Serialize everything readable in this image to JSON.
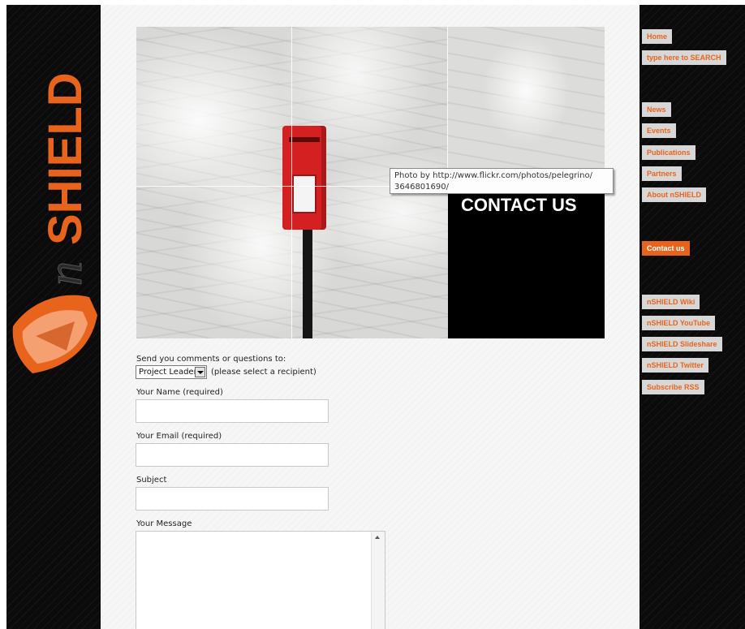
{
  "logo": {
    "text_n": "n",
    "text_shield": "SHIELD",
    "shield_color": "#e8641c"
  },
  "hero": {
    "title": "CONTACT US",
    "tooltip": "Photo by http://www.flickr.com/photos/pelegrino/ 3646801690/"
  },
  "form": {
    "recipient_intro": "Send you comments or questions to:",
    "recipient_selected": "Project Leader",
    "recipient_hint": "(please select a recipient)",
    "name_label": "Your Name (required)",
    "email_label": "Your Email (required)",
    "subject_label": "Subject",
    "message_label": "Your Message"
  },
  "nav": {
    "home": "Home",
    "search": "type here to SEARCH",
    "news": "News",
    "events": "Events",
    "publications": "Publications",
    "partners": "Partners",
    "about": "About nSHIELD",
    "contact": "Contact us",
    "wiki": "nSHIELD Wiki",
    "youtube": "nSHIELD YouTube",
    "slideshare": "nSHIELD Slideshare",
    "twitter": "nSHIELD Twitter",
    "rss": "Subscribe RSS"
  },
  "colors": {
    "accent": "#e8641c",
    "sidebar_bg": "#0b0b0b",
    "nav_bg": "#d7d7d7"
  }
}
